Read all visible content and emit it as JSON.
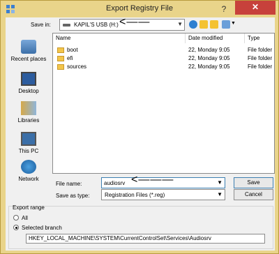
{
  "window": {
    "title": "Export Registry File",
    "help_glyph": "?",
    "close_glyph": "✕"
  },
  "toolbar": {
    "save_in_label": "Save in:",
    "save_in_value": "KAPIL'S USB (H:)",
    "annotation": "<——",
    "icons": [
      "back-icon",
      "up-folder-icon",
      "new-folder-icon",
      "view-menu-icon"
    ]
  },
  "places": [
    {
      "label": "Recent places",
      "icon": "recent-places-icon"
    },
    {
      "label": "Desktop",
      "icon": "desktop-icon"
    },
    {
      "label": "Libraries",
      "icon": "libraries-icon"
    },
    {
      "label": "This PC",
      "icon": "this-pc-icon"
    },
    {
      "label": "Network",
      "icon": "network-icon"
    }
  ],
  "filelist": {
    "columns": [
      "Name",
      "Date modified",
      "Type"
    ],
    "rows": [
      {
        "name": "boot",
        "date": "22, Monday 9:05",
        "type": "File folder"
      },
      {
        "name": "efi",
        "date": "22, Monday 9:05",
        "type": "File folder"
      },
      {
        "name": "sources",
        "date": "22, Monday 9:05",
        "type": "File folder"
      }
    ]
  },
  "form": {
    "file_name_label": "File name:",
    "file_name_value": "audiosrv",
    "annotation": "<———",
    "save_type_label": "Save as type:",
    "save_type_value": "Registration Files (*.reg)",
    "save_button": "Save",
    "cancel_button": "Cancel"
  },
  "export_range": {
    "title": "Export range",
    "all_label": "All",
    "selected_label": "Selected branch",
    "selected_option": "selected_branch",
    "branch_value": "HKEY_LOCAL_MACHINE\\SYSTEM\\CurrentControlSet\\Services\\Audiosrv"
  },
  "colors": {
    "title_bar": "#e9d48a",
    "close_button": "#c7413b",
    "focus_border": "#3c7fb1"
  }
}
